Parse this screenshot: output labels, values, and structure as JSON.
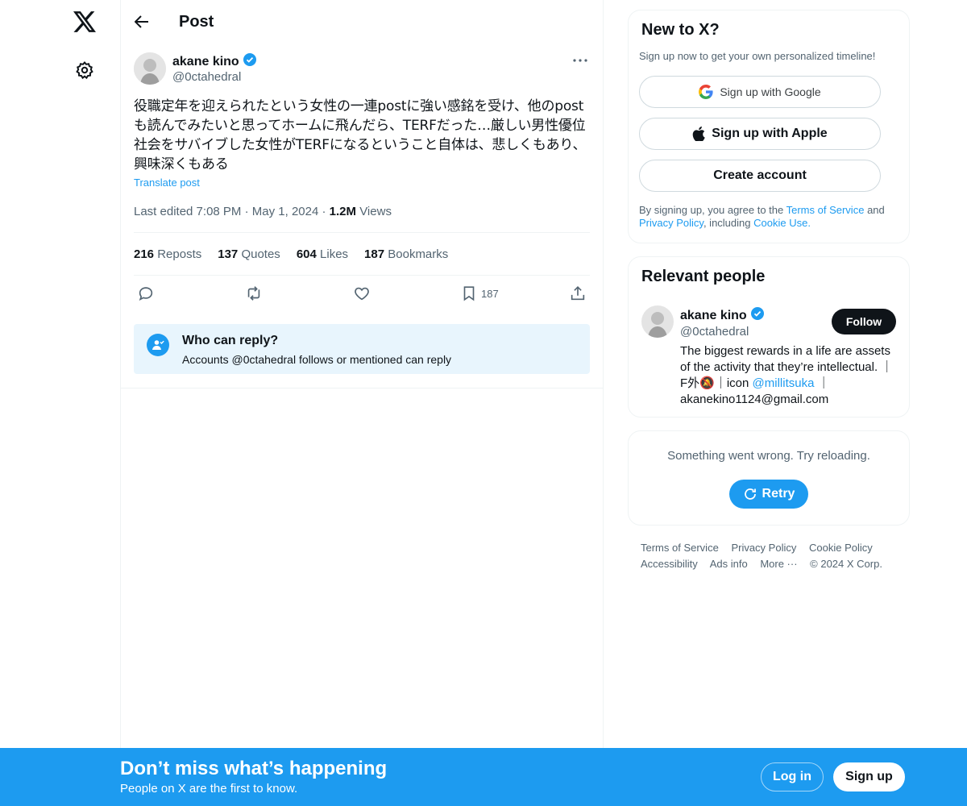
{
  "header": {
    "title": "Post"
  },
  "post": {
    "author_name": "akane kino",
    "author_handle": "@0ctahedral",
    "text": "役職定年を迎えられたという女性の一連postに強い感銘を受け、他のpostも読んでみたいと思ってホームに飛んだら、TERFだった…厳しい男性優位社会をサバイブした女性がTERFになるということ自体は、悲しくもあり、興味深くもある",
    "translate_label": "Translate post",
    "last_edited": "Last edited 7:08 PM",
    "date": "May 1, 2024",
    "views_count": "1.2M",
    "views_label": "Views",
    "stats": {
      "reposts_count": "216",
      "reposts_label": "Reposts",
      "quotes_count": "137",
      "quotes_label": "Quotes",
      "likes_count": "604",
      "likes_label": "Likes",
      "bookmarks_count": "187",
      "bookmarks_label": "Bookmarks"
    },
    "bookmark_action_count": "187",
    "reply_restriction": {
      "title": "Who can reply?",
      "subtitle": "Accounts @0ctahedral follows or mentioned can reply"
    }
  },
  "signup_card": {
    "title": "New to X?",
    "subtitle": "Sign up now to get your own personalized timeline!",
    "google_label": "Sign up with Google",
    "apple_label": "Sign up with Apple",
    "create_label": "Create account",
    "terms_prefix": "By signing up, you agree to the",
    "terms_link": "Terms of Service",
    "terms_and": "and",
    "privacy_link": "Privacy Policy",
    "terms_including": ", including",
    "cookie_link": "Cookie Use."
  },
  "relevant_people": {
    "title": "Relevant people",
    "name": "akane kino",
    "handle": "@0ctahedral",
    "follow_label": "Follow",
    "bio_1": "The biggest rewards in a life are assets of the activity that they’re intellectual. ｜ F外🔕｜icon",
    "bio_mention": "@millitsuka",
    "bio_2": "｜ akanekino1124@gmail.com"
  },
  "error_card": {
    "message": "Something went wrong. Try reloading.",
    "retry_label": "Retry"
  },
  "footer": {
    "terms": "Terms of Service",
    "privacy": "Privacy Policy",
    "cookie": "Cookie Policy",
    "accessibility": "Accessibility",
    "ads": "Ads info",
    "more": "More ···",
    "copyright": "© 2024 X Corp."
  },
  "bottom_bar": {
    "title": "Don’t miss what’s happening",
    "subtitle": "People on X are the first to know.",
    "login_label": "Log in",
    "signup_label": "Sign up"
  },
  "colors": {
    "accent": "#1d9bf0",
    "text": "#0f1419",
    "muted": "#536471"
  }
}
